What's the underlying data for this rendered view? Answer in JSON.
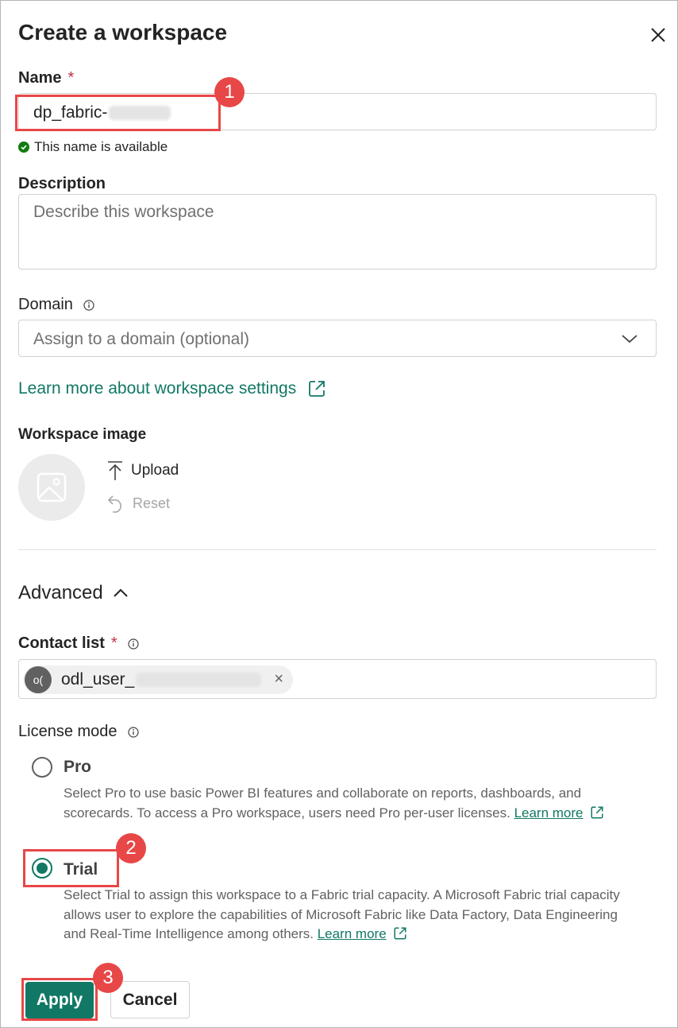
{
  "dialog": {
    "title": "Create a workspace",
    "close_icon": "close-icon"
  },
  "name_field": {
    "label": "Name",
    "required_mark": "*",
    "value": "dp_fabric-",
    "availability": "This name is available"
  },
  "description_field": {
    "label": "Description",
    "placeholder": "Describe this workspace"
  },
  "domain_field": {
    "label": "Domain",
    "placeholder": "Assign to a domain (optional)"
  },
  "learn_more_settings": "Learn more about workspace settings",
  "workspace_image": {
    "label": "Workspace image",
    "upload_label": "Upload",
    "reset_label": "Reset"
  },
  "advanced": {
    "label": "Advanced"
  },
  "contact_list": {
    "label": "Contact list",
    "required_mark": "*",
    "chip_initials": "o(",
    "chip_name": "odl_user_"
  },
  "license_mode": {
    "label": "License mode",
    "options": [
      {
        "label": "Pro",
        "selected": false,
        "description": "Select Pro to use basic Power BI features and collaborate on reports, dashboards, and scorecards. To access a Pro workspace, users need Pro per-user licenses.",
        "link": "Learn more"
      },
      {
        "label": "Trial",
        "selected": true,
        "description": "Select Trial to assign this workspace to a Fabric trial capacity. A Microsoft Fabric trial capacity allows user to explore the capabilities of Microsoft Fabric like Data Factory, Data Engineering and Real-Time Intelligence among others.",
        "link": "Learn more"
      }
    ]
  },
  "buttons": {
    "apply": "Apply",
    "cancel": "Cancel"
  },
  "callouts": [
    "1",
    "2",
    "3"
  ],
  "colors": {
    "accent": "#117865",
    "callout": "#e84747",
    "success": "#107c10",
    "required": "#c4314b"
  }
}
